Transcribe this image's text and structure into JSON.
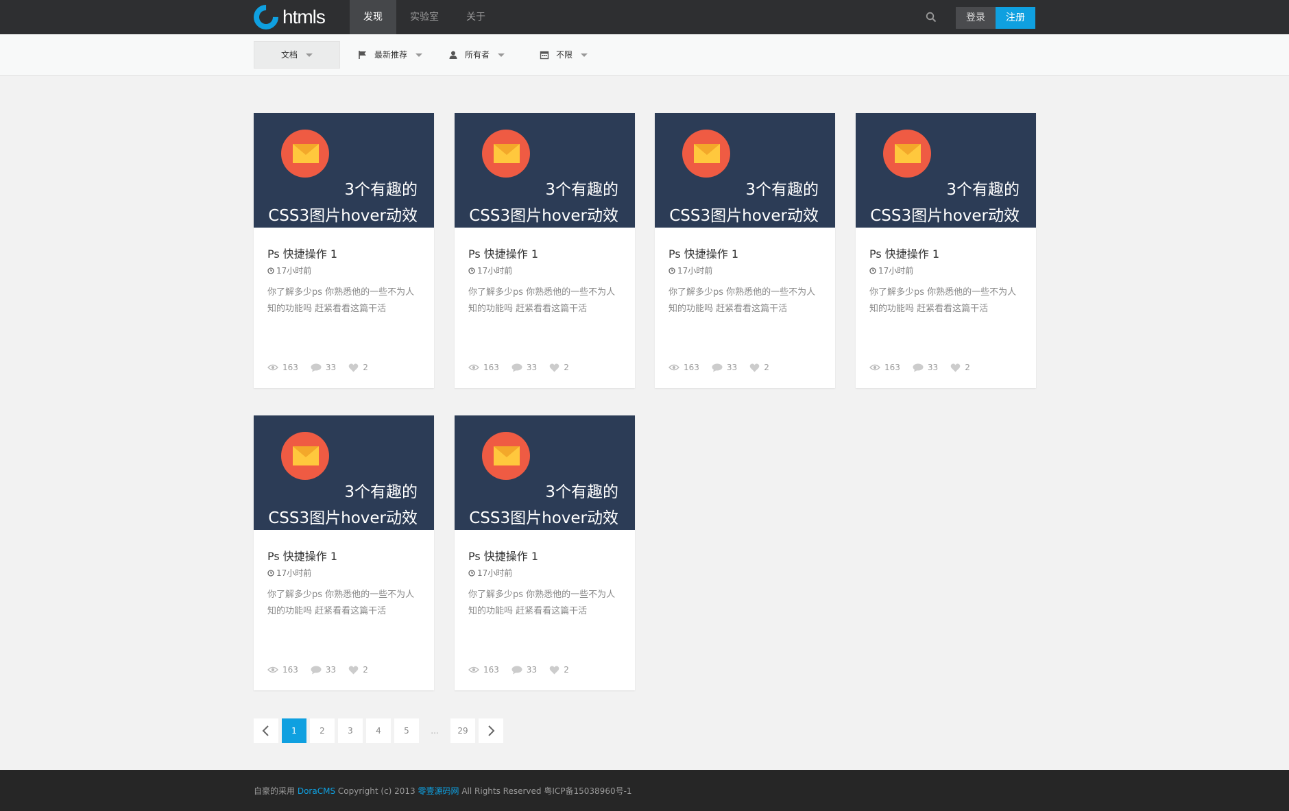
{
  "header": {
    "logo_text": "htmls",
    "nav": [
      {
        "label": "发现",
        "active": true
      },
      {
        "label": "实验室",
        "active": false
      },
      {
        "label": "关于",
        "active": false
      }
    ],
    "login_label": "登录",
    "register_label": "注册"
  },
  "filters": [
    {
      "label": "文档",
      "icon": "none",
      "active": true
    },
    {
      "label": "最新推荐",
      "icon": "flag-icon",
      "active": false
    },
    {
      "label": "所有者",
      "icon": "user-icon",
      "active": false
    },
    {
      "label": "不限",
      "icon": "calendar-icon",
      "active": false
    }
  ],
  "cards": [
    {
      "thumb_line1": "3个有趣的",
      "thumb_line2": "CSS3图片hover动效",
      "title": "Ps 快捷操作 1",
      "time": "17小时前",
      "desc": "你了解多少ps 你熟悉他的一些不为人知的功能吗 赶紧看看这篇干活",
      "views": "163",
      "comments": "33",
      "likes": "2"
    },
    {
      "thumb_line1": "3个有趣的",
      "thumb_line2": "CSS3图片hover动效",
      "title": "Ps 快捷操作 1",
      "time": "17小时前",
      "desc": "你了解多少ps 你熟悉他的一些不为人知的功能吗 赶紧看看这篇干活",
      "views": "163",
      "comments": "33",
      "likes": "2"
    },
    {
      "thumb_line1": "3个有趣的",
      "thumb_line2": "CSS3图片hover动效",
      "title": "Ps 快捷操作 1",
      "time": "17小时前",
      "desc": "你了解多少ps 你熟悉他的一些不为人知的功能吗 赶紧看看这篇干活",
      "views": "163",
      "comments": "33",
      "likes": "2"
    },
    {
      "thumb_line1": "3个有趣的",
      "thumb_line2": "CSS3图片hover动效",
      "title": "Ps 快捷操作 1",
      "time": "17小时前",
      "desc": "你了解多少ps 你熟悉他的一些不为人知的功能吗 赶紧看看这篇干活",
      "views": "163",
      "comments": "33",
      "likes": "2"
    },
    {
      "thumb_line1": "3个有趣的",
      "thumb_line2": "CSS3图片hover动效",
      "title": "Ps 快捷操作 1",
      "time": "17小时前",
      "desc": "你了解多少ps 你熟悉他的一些不为人知的功能吗 赶紧看看这篇干活",
      "views": "163",
      "comments": "33",
      "likes": "2"
    },
    {
      "thumb_line1": "3个有趣的",
      "thumb_line2": "CSS3图片hover动效",
      "title": "Ps 快捷操作 1",
      "time": "17小时前",
      "desc": "你了解多少ps 你熟悉他的一些不为人知的功能吗 赶紧看看这篇干活",
      "views": "163",
      "comments": "33",
      "likes": "2"
    }
  ],
  "pagination": {
    "pages": [
      "1",
      "2",
      "3",
      "4",
      "5"
    ],
    "ellipsis": "...",
    "last": "29",
    "current": "1"
  },
  "footer": {
    "prefix": "自豪的采用",
    "cms_link": "DoraCMS",
    "copyright": "Copyright (c) 2013",
    "site_link": "零壹源码网",
    "suffix": "All Rights Reserved 粤ICP备15038960号-1"
  },
  "colors": {
    "accent": "#0fa0e0",
    "topbar": "#2e2f31",
    "thumb_bg": "#2c3c56",
    "thumb_circle": "#ef5b43",
    "envelope": "#ffc83d"
  }
}
